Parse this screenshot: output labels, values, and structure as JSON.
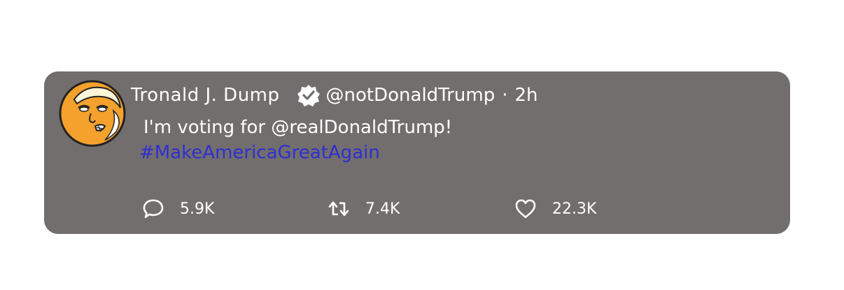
{
  "tweet": {
    "display_name": "Tronald J. Dump",
    "verified_icon": "verified-badge-icon",
    "handle": "@notDonaldTrump",
    "separator": "·",
    "time": "2h",
    "text": "I'm voting for @realDonaldTrump!",
    "hashtag": "#MakeAmericaGreatAgain",
    "hashtag_color": "#2e2fd0",
    "card_color": "#726e6e",
    "avatar_icon": "cartoon-avatar",
    "actions": {
      "reply": {
        "icon": "reply-icon",
        "count": "5.9K"
      },
      "retweet": {
        "icon": "retweet-icon",
        "count": "7.4K"
      },
      "like": {
        "icon": "heart-icon",
        "count": "22.3K"
      }
    }
  }
}
